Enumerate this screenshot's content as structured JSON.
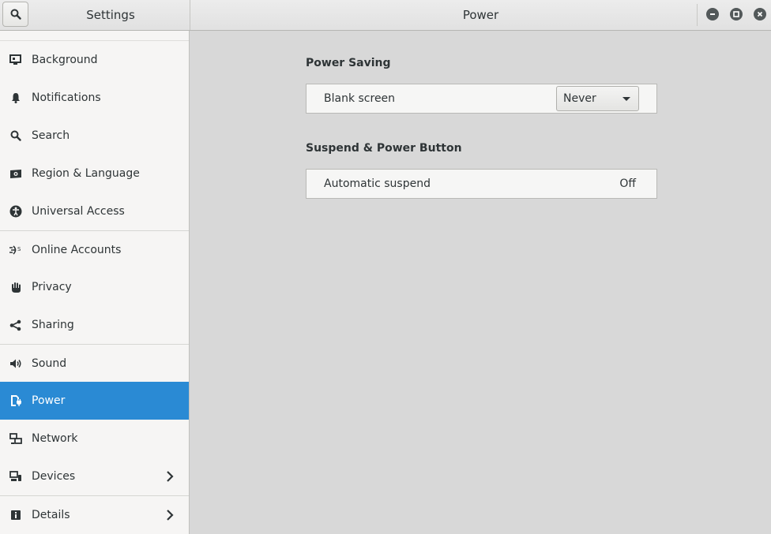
{
  "window": {
    "sidebar_title": "Settings",
    "panel_title": "Power",
    "controls": [
      "minimize-icon",
      "maximize-icon",
      "close-icon"
    ]
  },
  "sidebar": {
    "items": [
      {
        "label": "Background",
        "icon": "background-icon"
      },
      {
        "label": "Notifications",
        "icon": "bell-icon"
      },
      {
        "label": "Search",
        "icon": "search-icon"
      },
      {
        "label": "Region & Language",
        "icon": "region-icon"
      },
      {
        "label": "Universal Access",
        "icon": "accessibility-icon"
      },
      {
        "label": "Online Accounts",
        "icon": "online-accounts-icon"
      },
      {
        "label": "Privacy",
        "icon": "hand-icon"
      },
      {
        "label": "Sharing",
        "icon": "share-icon"
      },
      {
        "label": "Sound",
        "icon": "speaker-icon"
      },
      {
        "label": "Power",
        "icon": "power-plug-icon",
        "selected": true
      },
      {
        "label": "Network",
        "icon": "network-icon"
      },
      {
        "label": "Devices",
        "icon": "devices-icon",
        "has_submenu": true
      },
      {
        "label": "Details",
        "icon": "info-icon",
        "has_submenu": true
      }
    ]
  },
  "power": {
    "power_saving": {
      "title": "Power Saving",
      "blank_screen_label": "Blank screen",
      "blank_screen_value": "Never"
    },
    "suspend": {
      "title": "Suspend & Power Button",
      "automatic_suspend_label": "Automatic suspend",
      "automatic_suspend_value": "Off"
    }
  },
  "colors": {
    "accent": "#2a8ad4",
    "sidebar_bg": "#f6f5f4",
    "content_bg": "#d8d8d8"
  }
}
